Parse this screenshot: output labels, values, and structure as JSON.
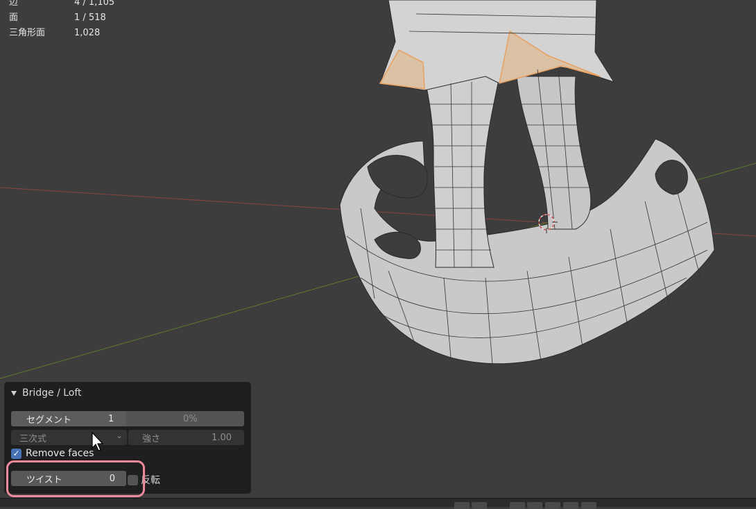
{
  "stats": {
    "rows": [
      {
        "label": "辺",
        "value": "4 / 1,105"
      },
      {
        "label": "面",
        "value": "1 / 518"
      },
      {
        "label": "三角形面",
        "value": "1,028"
      }
    ]
  },
  "operator_panel": {
    "title": "Bridge / Loft",
    "segments_label": "セグメント",
    "segments_value": "1",
    "smoothness_value": "0%",
    "interpolation_label": "三次式",
    "strength_label": "強さ",
    "strength_value": "1.00",
    "remove_faces_label": "Remove faces",
    "remove_faces_checked": true,
    "twist_label": "ツイスト",
    "twist_value": "0",
    "reverse_label": "反転",
    "reverse_checked": false
  },
  "colors": {
    "viewport_bg": "#3d3d3d",
    "mesh_fill": "#c8c8c8",
    "selection_orange": "#e8a060",
    "x_axis": "#9a4040",
    "y_axis": "#6a8a30",
    "highlight_box": "#ee8a9c",
    "checkbox_accent": "#4772b3"
  },
  "icons": {
    "panel_collapse": "triangle-down-icon",
    "dropdown": "chevron-down-icon",
    "checkmark": "checkmark-icon",
    "cursor": "mouse-pointer-icon",
    "origin": "3d-cursor-icon"
  }
}
